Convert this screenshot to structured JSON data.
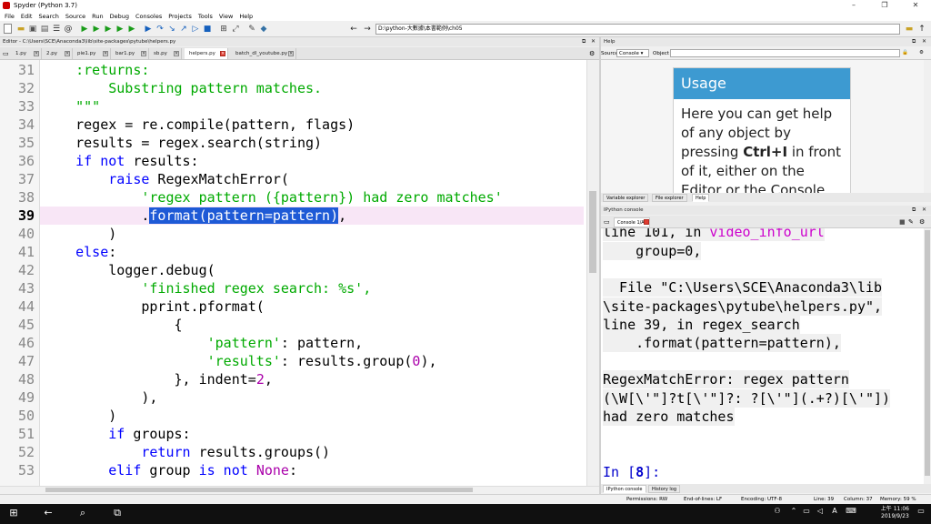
{
  "window": {
    "title": "Spyder (Python 3.7)",
    "minimize": "–",
    "restore": "❐",
    "close": "✕"
  },
  "menu": [
    "File",
    "Edit",
    "Search",
    "Source",
    "Run",
    "Debug",
    "Consoles",
    "Projects",
    "Tools",
    "View",
    "Help"
  ],
  "toolbar": {
    "path": "D:\\python-大數據\\本書範例\\ch05",
    "icons": [
      "new-file-icon",
      "open-file-icon",
      "save-icon",
      "save-all-icon",
      "list-icon",
      "at-icon",
      "run-icon",
      "run-file-icon",
      "run-cell-icon",
      "run-cell-advance-icon",
      "run-selection-icon",
      "debug-icon",
      "step-icon",
      "step-into-icon",
      "step-return-icon",
      "continue-icon",
      "stop-icon",
      "maximize-icon",
      "fullscreen-icon",
      "preferences-icon",
      "python-icon",
      "back-arrow-icon",
      "forward-arrow-icon",
      "browse-folder-icon",
      "up-arrow-icon"
    ]
  },
  "editor": {
    "pane_title": "Editor - C:\\Users\\SCE\\Anaconda3\\lib\\site-packages\\pytube\\helpers.py",
    "tabs": [
      {
        "label": "1.py",
        "active": false
      },
      {
        "label": "2.py",
        "active": false
      },
      {
        "label": "pie1.py",
        "active": false
      },
      {
        "label": "bar1.py",
        "active": false
      },
      {
        "label": "sb.py",
        "active": false
      },
      {
        "label": "helpers.py",
        "active": true
      },
      {
        "label": "batch_dl_youtube.py",
        "active": false
      }
    ],
    "current_line": 39,
    "lines": [
      {
        "n": "31",
        "t": "    :returns:"
      },
      {
        "n": "32",
        "t": "        Substring pattern matches."
      },
      {
        "n": "33",
        "t": "    \"\"\""
      },
      {
        "n": "34",
        "t": "    regex = re.compile(pattern, flags)"
      },
      {
        "n": "35",
        "t": "    results = regex.search(string)"
      },
      {
        "n": "36",
        "t": "    if not results:"
      },
      {
        "n": "37",
        "t": "        raise RegexMatchError("
      },
      {
        "n": "38",
        "t": "            'regex pattern ({pattern}) had zero matches'"
      },
      {
        "n": "39",
        "t": "            .format(pattern=pattern),"
      },
      {
        "n": "40",
        "t": "        )"
      },
      {
        "n": "41",
        "t": "    else:"
      },
      {
        "n": "42",
        "t": "        logger.debug("
      },
      {
        "n": "43",
        "t": "            'finished regex search: %s',"
      },
      {
        "n": "44",
        "t": "            pprint.pformat("
      },
      {
        "n": "45",
        "t": "                {"
      },
      {
        "n": "46",
        "t": "                    'pattern': pattern,"
      },
      {
        "n": "47",
        "t": "                    'results': results.group(0),"
      },
      {
        "n": "48",
        "t": "                }, indent=2,"
      },
      {
        "n": "49",
        "t": "            ),"
      },
      {
        "n": "50",
        "t": "        )"
      },
      {
        "n": "51",
        "t": "        if groups:"
      },
      {
        "n": "52",
        "t": "            return results.groups()"
      },
      {
        "n": "53",
        "t": "        elif group is not None:"
      }
    ]
  },
  "help": {
    "pane_title": "Help",
    "source_label": "Source",
    "source_value": "Console",
    "object_label": "Object",
    "usage_title": "Usage",
    "usage_body_1": "Here you can get help of any object by pressing ",
    "usage_bold": "Ctrl+I",
    "usage_body_2": " in front of it, either on the Editor or the Console.",
    "tabs": [
      "Variable explorer",
      "File explorer",
      "Help"
    ]
  },
  "console": {
    "pane_title": "IPython console",
    "tab_label": "Console 1/A",
    "lines": {
      "l1a": "line 101, in ",
      "l1b": "video_info_url",
      "l2": "    group=0,",
      "l3": "  File \"C:\\Users\\SCE\\Anaconda3\\lib",
      "l4": "\\site-packages\\pytube\\helpers.py\",",
      "l5": "line 39, in regex_search",
      "l6": "    .format(pattern=pattern),",
      "l7": "RegexMatchError: regex pattern",
      "l8": "(\\W[\\'\"]?t[\\'\"]?: ?[\\'\"](.+?)[\\'\"])",
      "l9": "had zero matches",
      "prompt_a": "In [",
      "prompt_n": "8",
      "prompt_b": "]:"
    },
    "tabs": [
      "IPython console",
      "History log"
    ]
  },
  "status": {
    "permissions": "Permissions: RW",
    "eol": "End-of-lines: LF",
    "encoding": "Encoding: UTF-8",
    "line": "Line: 39",
    "column": "Column: 37",
    "memory": "Memory: 59 %"
  },
  "taskbar": {
    "time": "上午 11:06",
    "date": "2019/9/23",
    "ime": "A"
  }
}
